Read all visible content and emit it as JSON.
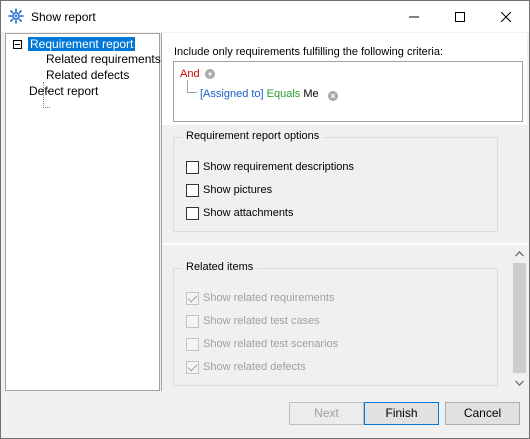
{
  "window": {
    "title": "Show report",
    "icons": {
      "app": "gear-network-icon",
      "minimize": "minimize-icon",
      "maximize": "maximize-icon",
      "close": "close-icon"
    }
  },
  "tree": {
    "items": [
      {
        "label": "Requirement report",
        "selected": true,
        "expanded": true
      },
      {
        "label": "Related requirements"
      },
      {
        "label": "Related defects"
      },
      {
        "label": "Defect report"
      }
    ]
  },
  "criteria": {
    "label": "Include only requirements fulfilling the following criteria:",
    "operator": "And",
    "condition": {
      "field": "[Assigned to]",
      "op": "Equals",
      "value": "Me"
    },
    "colors": {
      "operator": "#d00000",
      "field": "#1a5dc8",
      "op": "#2c9a2c"
    }
  },
  "report_options": {
    "title": "Requirement report options",
    "items": [
      {
        "label": "Show requirement descriptions",
        "checked": false
      },
      {
        "label": "Show pictures",
        "checked": false
      },
      {
        "label": "Show attachments",
        "checked": false
      }
    ]
  },
  "related_items": {
    "title": "Related items",
    "items": [
      {
        "label": "Show related requirements",
        "checked": true,
        "disabled": true
      },
      {
        "label": "Show related test cases",
        "checked": false,
        "disabled": true
      },
      {
        "label": "Show related test scenarios",
        "checked": false,
        "disabled": true
      },
      {
        "label": "Show related defects",
        "checked": true,
        "disabled": true
      }
    ]
  },
  "buttons": {
    "next": "Next",
    "finish": "Finish",
    "cancel": "Cancel"
  }
}
